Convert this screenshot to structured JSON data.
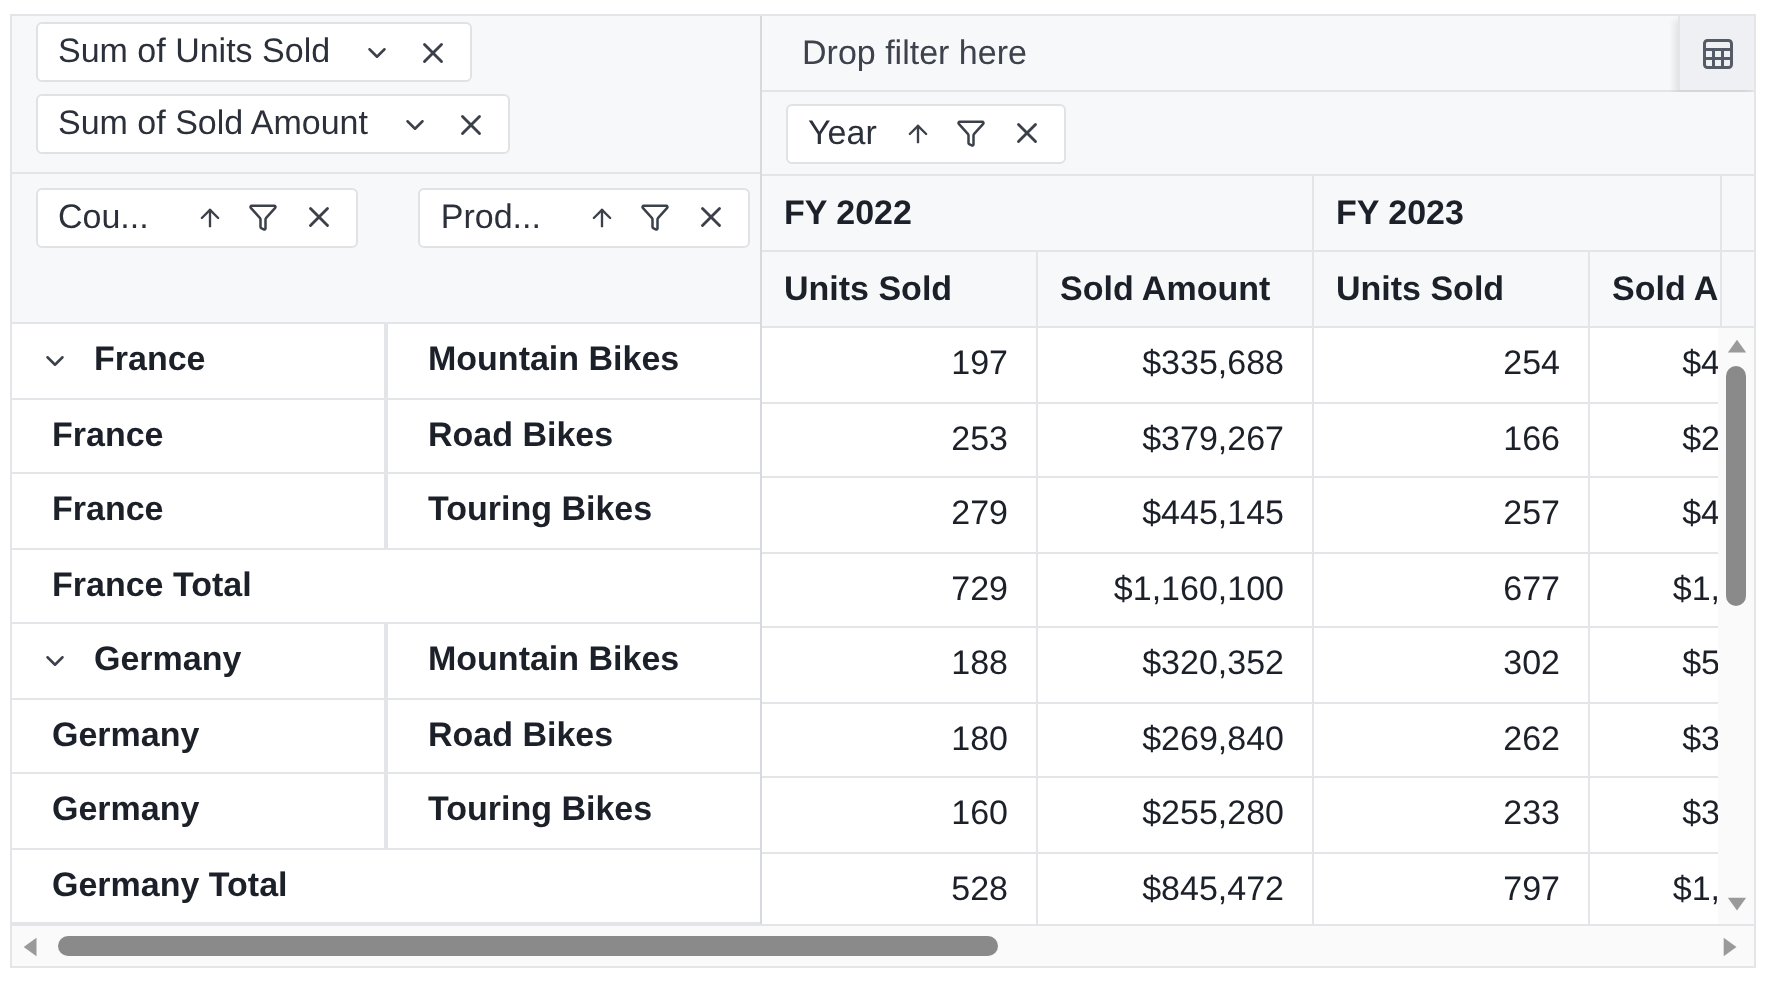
{
  "value_chips": [
    {
      "label": "Sum of Units Sold"
    },
    {
      "label": "Sum of Sold Amount"
    }
  ],
  "row_chips": [
    {
      "label": "Cou..."
    },
    {
      "label": "Prod..."
    }
  ],
  "filter_area": {
    "placeholder": "Drop filter here"
  },
  "column_chips": [
    {
      "label": "Year"
    }
  ],
  "column_groups": [
    {
      "label": "FY 2022"
    },
    {
      "label": "FY 2023"
    }
  ],
  "columns": [
    "Units Sold",
    "Sold Amount",
    "Units Sold",
    "Sold A"
  ],
  "rows": [
    {
      "kind": "group",
      "expanded": true,
      "country": "France",
      "product": "Mountain Bikes",
      "values": [
        "197",
        "$335,688",
        "254",
        "$4"
      ]
    },
    {
      "kind": "item",
      "country": "France",
      "product": "Road Bikes",
      "values": [
        "253",
        "$379,267",
        "166",
        "$2"
      ]
    },
    {
      "kind": "item",
      "country": "France",
      "product": "Touring Bikes",
      "values": [
        "279",
        "$445,145",
        "257",
        "$4"
      ]
    },
    {
      "kind": "total",
      "country": "France Total",
      "values": [
        "729",
        "$1,160,100",
        "677",
        "$1,"
      ]
    },
    {
      "kind": "group",
      "expanded": true,
      "country": "Germany",
      "product": "Mountain Bikes",
      "values": [
        "188",
        "$320,352",
        "302",
        "$5"
      ]
    },
    {
      "kind": "item",
      "country": "Germany",
      "product": "Road Bikes",
      "values": [
        "180",
        "$269,840",
        "262",
        "$3"
      ]
    },
    {
      "kind": "item",
      "country": "Germany",
      "product": "Touring Bikes",
      "values": [
        "160",
        "$255,280",
        "233",
        "$3"
      ]
    },
    {
      "kind": "total",
      "country": "Germany Total",
      "values": [
        "528",
        "$845,472",
        "797",
        "$1,"
      ]
    }
  ]
}
